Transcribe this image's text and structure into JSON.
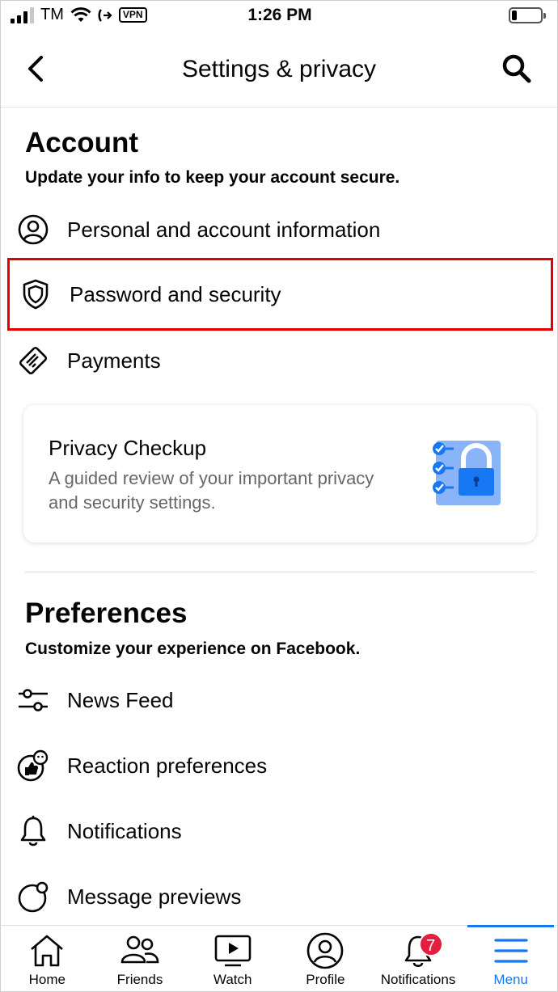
{
  "status_bar": {
    "carrier": "TM",
    "vpn": "VPN",
    "time": "1:26 PM"
  },
  "header": {
    "title": "Settings & privacy"
  },
  "account": {
    "title": "Account",
    "subtitle": "Update your info to keep your account secure.",
    "items": [
      {
        "label": "Personal and account information",
        "icon": "person-circle-icon"
      },
      {
        "label": "Password and security",
        "icon": "shield-icon"
      },
      {
        "label": "Payments",
        "icon": "card-icon"
      }
    ]
  },
  "privacy_checkup": {
    "title": "Privacy Checkup",
    "description": "A guided review of your important privacy and security settings.",
    "illustration": "lock-checklist-icon"
  },
  "preferences": {
    "title": "Preferences",
    "subtitle": "Customize your experience on Facebook.",
    "items": [
      {
        "label": "News Feed",
        "icon": "sliders-icon"
      },
      {
        "label": "Reaction preferences",
        "icon": "reaction-icon"
      },
      {
        "label": "Notifications",
        "icon": "bell-icon"
      },
      {
        "label": "Message previews",
        "icon": "message-preview-icon"
      }
    ]
  },
  "tabbar": {
    "tabs": [
      {
        "label": "Home",
        "icon": "home-icon"
      },
      {
        "label": "Friends",
        "icon": "friends-icon"
      },
      {
        "label": "Watch",
        "icon": "watch-icon"
      },
      {
        "label": "Profile",
        "icon": "profile-icon"
      },
      {
        "label": "Notifications",
        "icon": "bell-icon",
        "badge": "7"
      },
      {
        "label": "Menu",
        "icon": "menu-icon"
      }
    ],
    "active": "Menu"
  },
  "colors": {
    "accent": "#1877f2",
    "highlight_border": "#e00000",
    "badge": "#e41e3f",
    "secondary_text": "#65676b"
  }
}
